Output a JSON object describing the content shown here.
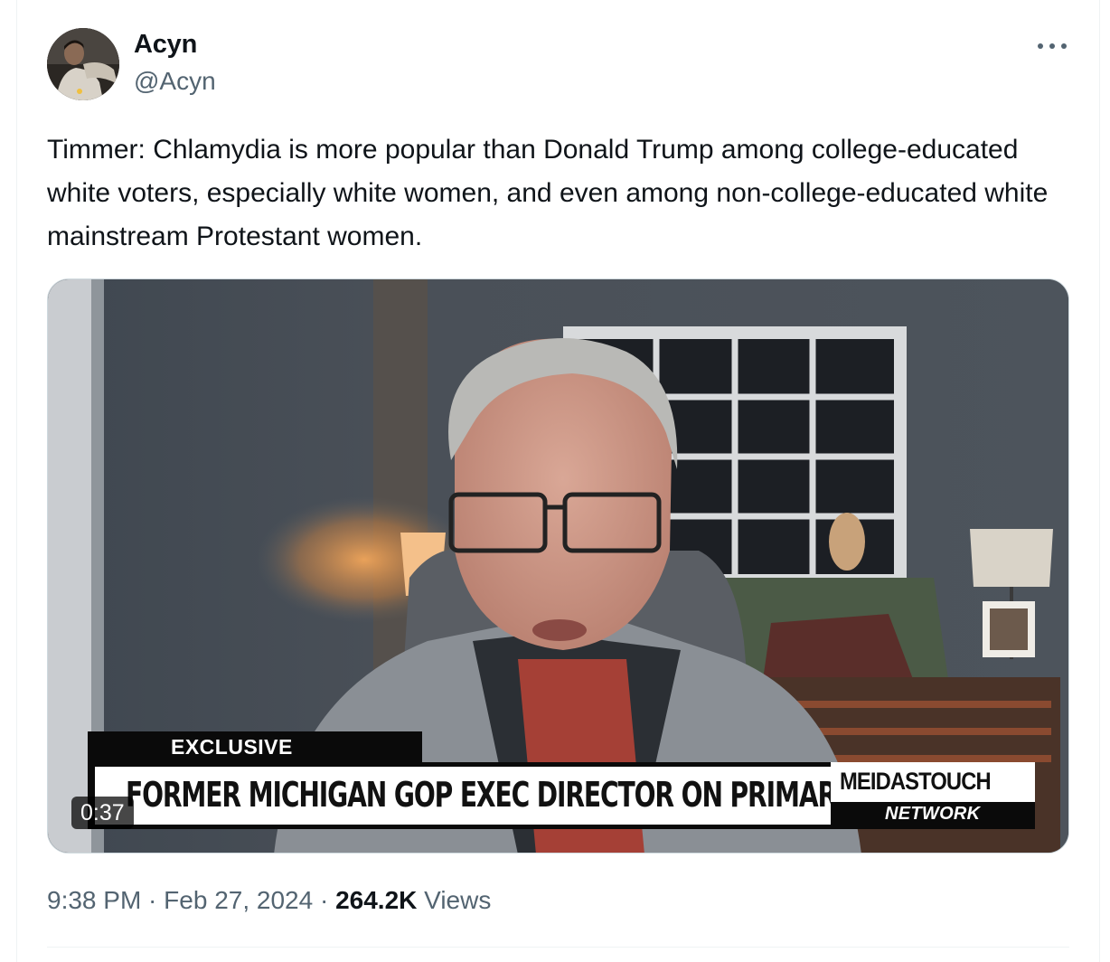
{
  "tweet": {
    "author": {
      "display_name": "Acyn",
      "handle": "@Acyn"
    },
    "more_icon": "more-horizontal-icon",
    "text": "Timmer: Chlamydia is more popular than Donald Trump among college-educated white voters, especially white women, and even among non-college-educated white mainstream Protestant women.",
    "video": {
      "duration": "0:37",
      "tag": "EXCLUSIVE",
      "headline": "FORMER MICHIGAN GOP EXEC DIRECTOR ON PRIMARY RESULTS",
      "brand_name": "MEIDASTOUCH",
      "brand_sub": "NETWORK"
    },
    "meta": {
      "time": "9:38 PM",
      "separator": " · ",
      "date": "Feb 27, 2024",
      "views_count": "264.2K",
      "views_label": " Views"
    }
  },
  "colors": {
    "text_primary": "#0f1419",
    "text_secondary": "#536471",
    "border": "#cfd9de"
  }
}
